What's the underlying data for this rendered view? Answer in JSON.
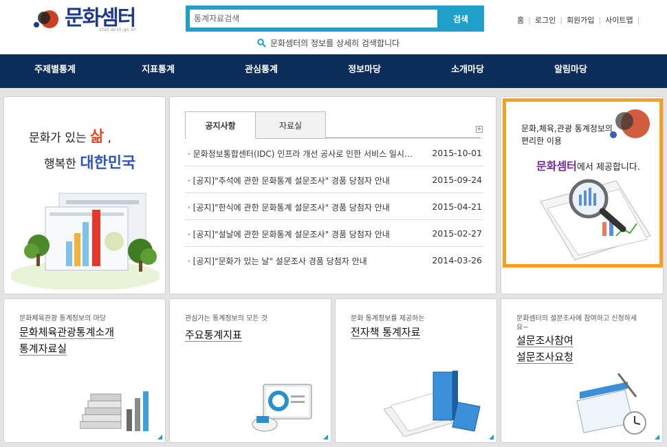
{
  "header": {
    "logo_text": "문화셈터",
    "logo_sub": "stat.mcst.go.kr",
    "search": {
      "placeholder": "통계자료검색",
      "button_label": "검색",
      "hint": "문화셈터의 정보를 상세히 검색합니다"
    },
    "util_links": [
      "홈",
      "로그인",
      "회원가입",
      "사이트맵"
    ]
  },
  "gnb": {
    "items": [
      "주제별통계",
      "지표통계",
      "관심통계",
      "정보마당",
      "소개마당",
      "알림마당"
    ]
  },
  "hero": {
    "line1_prefix": "문화가 있는 ",
    "line1_accent": "삶",
    "line1_suffix": " ,",
    "line2_prefix": "행복한 ",
    "line2_accent": "대한민국"
  },
  "notice": {
    "tabs": [
      "공지사항",
      "자료실"
    ],
    "items": [
      {
        "title": "문화정보통합센터(IDC) 인프라 개선 공사로 인한 서비스 일시 중단",
        "date": "2015-10-01"
      },
      {
        "title": "[공지]\"추석에 관한 문화통계 설문조사\" 경품 당첨자 안내",
        "date": "2015-09-24"
      },
      {
        "title": "[공지]\"한식에 관한 문화통계 설문조사\" 경품 당첨자 안내",
        "date": "2015-04-21"
      },
      {
        "title": "[공지]\"설날에 관한 문화통계 설문조사\" 경품 당첨자 안내",
        "date": "2015-02-27"
      },
      {
        "title": "[공지]\"문화가 있는 날\" 설문조사 경품 당첨자 안내",
        "date": "2014-03-26"
      }
    ]
  },
  "promo": {
    "line1": "문화,체육,관광 통계정보의",
    "line2": "편리한 이용",
    "brand": "문화셈터",
    "tagline": "에서 제공합니다."
  },
  "cards": [
    {
      "small": "문화체육관광 통계정보의 마당",
      "links": [
        "문화체육관광통계소개",
        "통계자료실"
      ]
    },
    {
      "small": "관심가는 통계정보의 모든 것",
      "links": [
        "주요통계지표"
      ]
    },
    {
      "small": "문화 통계정보를 제공하는",
      "links": [
        "전자책 통계자료"
      ]
    },
    {
      "small": "문화셈터의 설문조사에 참여하고 신청하세요~",
      "links": [
        "설문조사참여",
        "설문조사요청"
      ]
    }
  ],
  "colors": {
    "nav_bg": "#0c2c59",
    "search_accent": "#1ea0c9",
    "promo_border": "#f5a021",
    "logo_blue": "#1e3b8a"
  }
}
